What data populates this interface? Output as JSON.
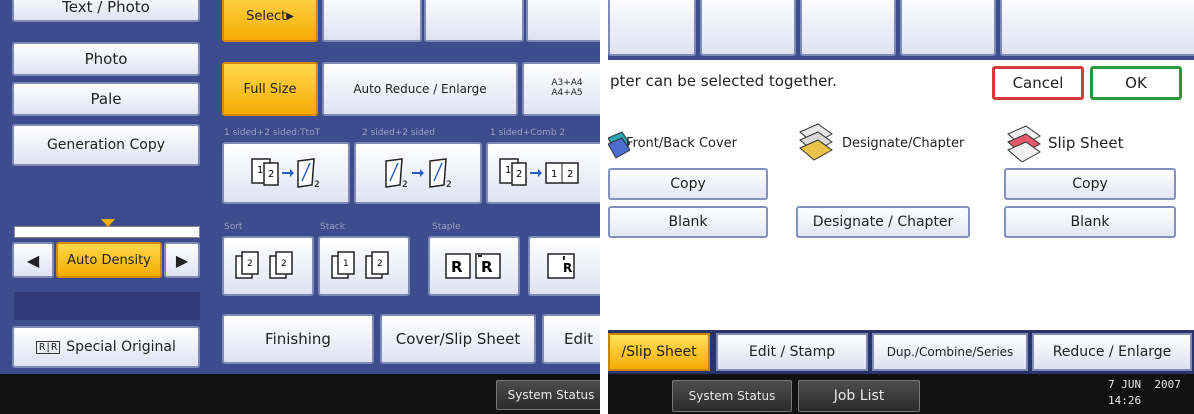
{
  "left": {
    "side_buttons": [
      "Text / Photo",
      "Photo",
      "Pale",
      "Generation Copy"
    ],
    "select_label": "Select",
    "size_buttons": {
      "full_size": "Full Size",
      "auto_reduce": "Auto Reduce / Enlarge",
      "paper_sizes": "A3+A4\nA4+A5"
    },
    "duplex_labels": [
      "1 sided+2 sided:TtoT",
      "2 sided+2 sided",
      "1 sided+Comb 2"
    ],
    "finish_labels": [
      "Sort",
      "Stack",
      "Staple"
    ],
    "auto_density": "Auto Density",
    "special_original": "Special Original",
    "bottom_tabs": [
      "Finishing",
      "Cover/Slip Sheet",
      "Edit"
    ],
    "system_status": "System Status"
  },
  "right": {
    "message": "pter can be selected together.",
    "cancel_label": "Cancel",
    "ok_label": "OK",
    "columns": [
      {
        "title": "Front/Back Cover",
        "buttons": [
          "Copy",
          "Blank"
        ]
      },
      {
        "title": "Designate/Chapter",
        "buttons": [
          "Designate / Chapter"
        ]
      },
      {
        "title": "Slip Sheet",
        "buttons": [
          "Copy",
          "Blank"
        ]
      }
    ],
    "tabs": [
      "/Slip Sheet",
      "Edit / Stamp",
      "Dup./Combine/Series",
      "Reduce / Enlarge"
    ],
    "system_status": "System Status",
    "job_list": "Job List",
    "date": "7 JUN  2007",
    "time": "14:26"
  },
  "colors": {
    "panel_bg": "#3c4c8c",
    "selected": "#f5ac05",
    "ok_border": "#2e9a3a",
    "cancel_border": "#d23a3a"
  }
}
